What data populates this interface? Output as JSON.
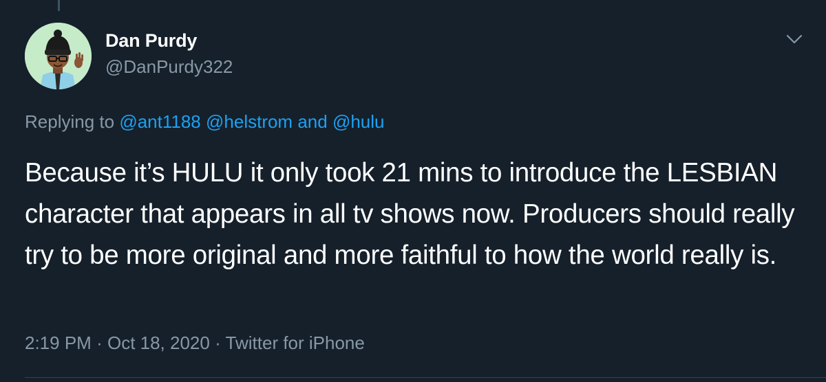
{
  "author": {
    "name": "Dan Purdy",
    "handle": "@DanPurdy322"
  },
  "reply_line": {
    "prefix": "Replying to",
    "mention_1": "@ant1188",
    "mention_2": "@helstrom",
    "conjunction": "and",
    "mention_3": "@hulu"
  },
  "tweet": {
    "text": "Because it’s HULU it only took 21 mins to introduce the LESBIAN character that appears in all tv shows now. Producers should really try to be more original and more faithful to how the world really is."
  },
  "meta": {
    "time": "2:19 PM",
    "separator": "·",
    "date": "Oct 18, 2020",
    "source": "Twitter for iPhone"
  },
  "colors": {
    "background": "#15202b",
    "secondary_text": "#8899a6",
    "link": "#1da1f2",
    "avatar_bg": "#c6ebc9"
  },
  "icons": {
    "caret": "chevron-down-icon"
  }
}
